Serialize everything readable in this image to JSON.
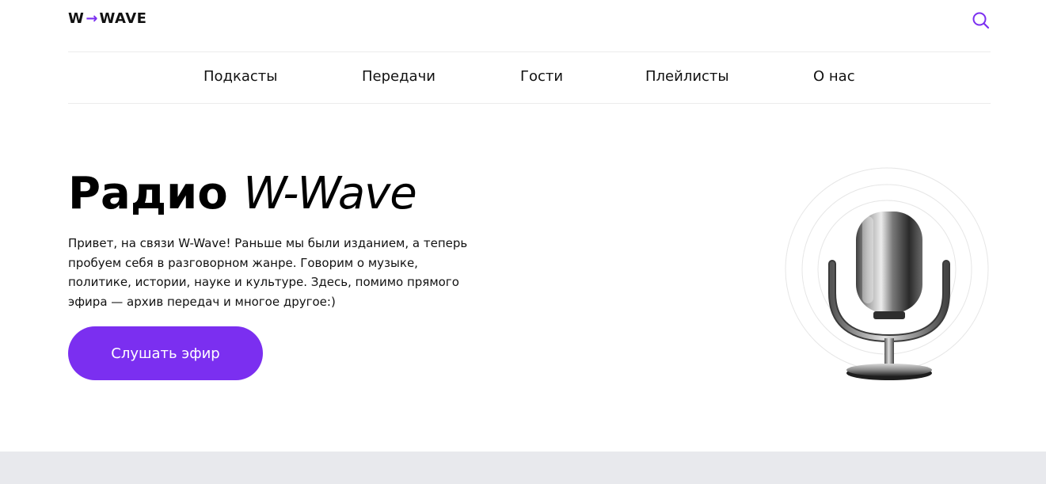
{
  "header": {
    "logo": {
      "left": "W",
      "arrow": "→",
      "right": "WAVE"
    },
    "search_icon": "search-icon"
  },
  "nav": {
    "items": [
      {
        "label": "Подкасты"
      },
      {
        "label": "Передачи"
      },
      {
        "label": "Гости"
      },
      {
        "label": "Плейлисты"
      },
      {
        "label": "О нас"
      }
    ]
  },
  "hero": {
    "title_bold": "Радио",
    "title_italic": "W-Wave",
    "text": "Привет, на связи W-Wave! Раньше мы были изданием, а теперь пробуем себя в разговорном жанре. Говорим о музыке, политике, истории, науке и культуре. Здесь, помимо прямого эфира — архив передач и многое другое:)",
    "cta_label": "Слушать эфир",
    "illustration_icon": "microphone-icon"
  },
  "colors": {
    "accent": "#7b2ff0",
    "text": "#111111",
    "divider": "#ececec",
    "footer_band": "#e8e9ed"
  }
}
